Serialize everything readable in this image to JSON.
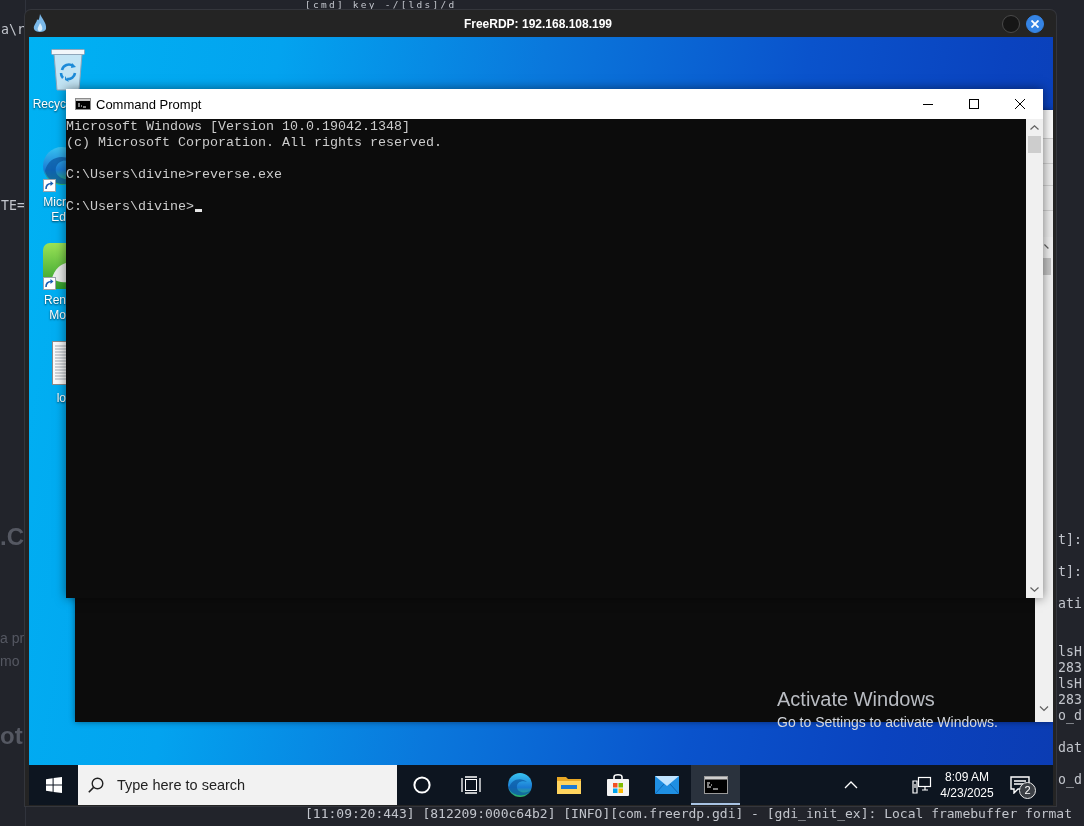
{
  "host_terminal": {
    "top_line": "[cmd] key -/[lds]/d",
    "left_fragments": [
      {
        "kind": "code",
        "text": "a\\r"
      },
      {
        "kind": "code",
        "text": "TE="
      },
      {
        "kind": "heading",
        "text": ".C"
      },
      {
        "kind": "text",
        "text": "a pr"
      },
      {
        "kind": "text",
        "text": "mo"
      },
      {
        "kind": "heading",
        "text": "ot"
      }
    ],
    "right_fragments": [
      "t]:",
      "t]:",
      "ati",
      "lsH",
      "283",
      "lsH",
      "283",
      "o_d",
      "dat",
      "o_d"
    ],
    "bottom_line": "[11:09:20:443] [812209:000c64b2] [INFO][com.freerdp.gdi] - [gdi_init_ex]: Local framebuffer format"
  },
  "window": {
    "title": "FreeRDP: 192.168.108.199"
  },
  "desktop_icons": [
    {
      "kind": "bin",
      "shortcut": false,
      "label_lines": [
        "Recyc"
      ]
    },
    {
      "kind": "browser",
      "shortcut": true,
      "label_lines": [
        "Micr",
        "Ed"
      ]
    },
    {
      "kind": "app",
      "shortcut": true,
      "label_lines": [
        "Ren",
        "Mo"
      ]
    },
    {
      "kind": "document",
      "shortcut": false,
      "label_lines": [
        "lo"
      ]
    }
  ],
  "console": {
    "title": "Command Prompt",
    "blocks": [
      {
        "lines": [
          "Microsoft Windows [Version 10.0.19042.1348]",
          "(c) Microsoft Corporation. All rights reserved."
        ],
        "cursor": false
      },
      {
        "lines": [
          "C:\\Users\\divine>reverse.exe"
        ],
        "cursor": false
      },
      {
        "lines": [
          "C:\\Users\\divine>"
        ],
        "cursor": true
      }
    ]
  },
  "activation_notice": {
    "heading": "Activate Windows",
    "hint": "Go to Settings to activate Windows."
  },
  "taskbar": {
    "search": {
      "placeholder": "Type here to search"
    },
    "buttons": [
      {
        "kind": "assistant",
        "active": false
      },
      {
        "kind": "task-view",
        "active": false
      },
      {
        "kind": "browser",
        "active": false
      },
      {
        "kind": "files",
        "active": false
      },
      {
        "kind": "store",
        "active": false
      },
      {
        "kind": "mail",
        "active": false
      },
      {
        "kind": "terminal",
        "active": true
      }
    ],
    "clock": {
      "time": "8:09 AM",
      "date": "4/23/2025"
    },
    "notifications": {
      "badge": "2"
    }
  }
}
